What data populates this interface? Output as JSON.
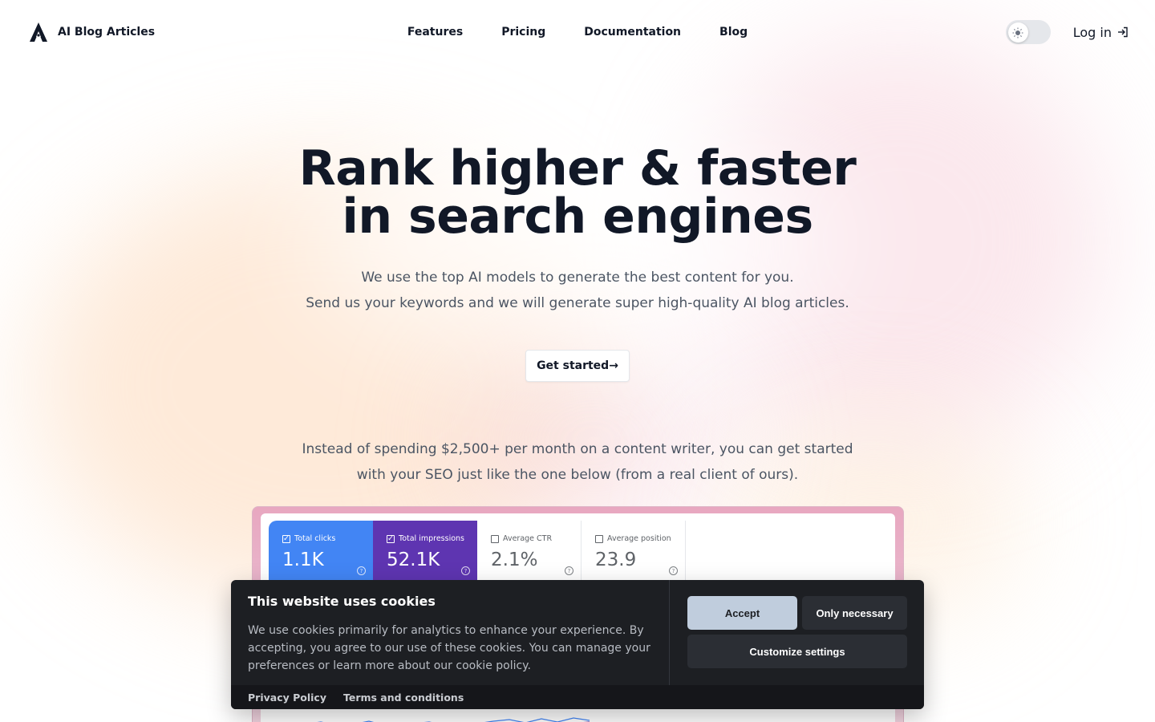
{
  "brand": {
    "name": "AI Blog Articles"
  },
  "nav": {
    "features": "Features",
    "pricing": "Pricing",
    "documentation": "Documentation",
    "blog": "Blog"
  },
  "header": {
    "login_label": "Log in"
  },
  "hero": {
    "title": "Rank higher & faster in search engines",
    "subtitle_line1": "We use the top AI models to generate the best content for you.",
    "subtitle_line2": "Send us your keywords and we will generate super high-quality AI blog articles.",
    "cta_label": "Get started→"
  },
  "pitch": {
    "line1": "Instead of spending $2,500+ per month on a content writer, you can get started",
    "line2": "with your SEO just like the one below (from a real client of ours)."
  },
  "dashboard": {
    "metrics": [
      {
        "label": "Total clicks",
        "value": "1.1K",
        "checked": true,
        "color": "#4285f4"
      },
      {
        "label": "Total impressions",
        "value": "52.1K",
        "checked": true,
        "color": "#5e35b1"
      },
      {
        "label": "Average CTR",
        "value": "2.1%",
        "checked": false
      },
      {
        "label": "Average position",
        "value": "23.9",
        "checked": false
      }
    ],
    "axis_left": "0",
    "axis_right": "0"
  },
  "cookie": {
    "title": "This website uses cookies",
    "text": "We use cookies primarily for analytics to enhance your experience. By accepting, you agree to our use of these cookies. You can manage your preferences or learn more about our cookie policy.",
    "accept_label": "Accept",
    "only_necessary_label": "Only necessary",
    "customize_label": "Customize settings",
    "privacy_label": "Privacy Policy",
    "terms_label": "Terms and conditions"
  },
  "colors": {
    "text": "#111827",
    "muted": "#4b5563",
    "cookie_bg": "#1d1f23",
    "accept_bg": "#c0cddd"
  }
}
